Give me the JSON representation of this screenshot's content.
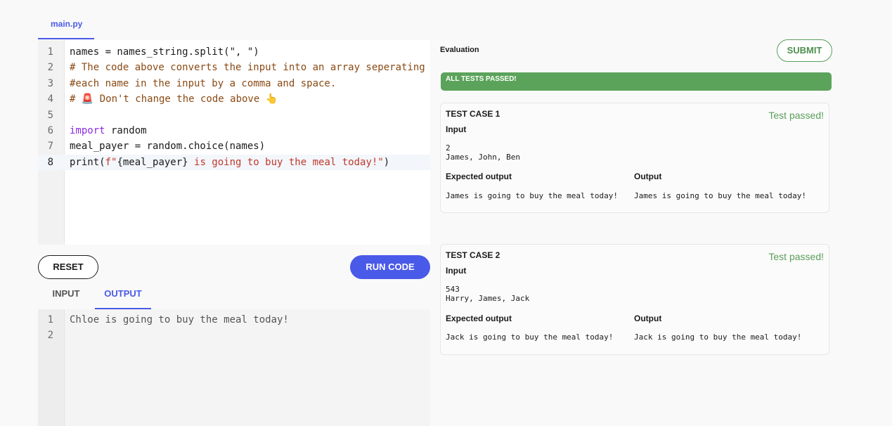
{
  "editor": {
    "file_tab": "main.py",
    "lines": [
      {
        "num": "1",
        "parts": [
          {
            "t": "names = names_string.split(\", \")",
            "c": ""
          }
        ]
      },
      {
        "num": "2",
        "parts": [
          {
            "t": "# The code above converts the input into an array seperating",
            "c": "cm"
          }
        ]
      },
      {
        "num": "3",
        "parts": [
          {
            "t": "#each name in the input by a comma and space.",
            "c": "cm"
          }
        ]
      },
      {
        "num": "4",
        "parts": [
          {
            "t": "# 🚨 Don't change the code above 👆",
            "c": "cm"
          }
        ]
      },
      {
        "num": "5",
        "parts": []
      },
      {
        "num": "6",
        "parts": [
          {
            "t": "import",
            "c": "kw"
          },
          {
            "t": " random",
            "c": ""
          }
        ]
      },
      {
        "num": "7",
        "parts": [
          {
            "t": "meal_payer = random.choice(names)",
            "c": ""
          }
        ]
      },
      {
        "num": "8",
        "parts": [
          {
            "t": "print(",
            "c": ""
          },
          {
            "t": "f\"",
            "c": "str"
          },
          {
            "t": "{meal_payer}",
            "c": ""
          },
          {
            "t": " is going to buy the meal today!\"",
            "c": "str"
          },
          {
            "t": ")",
            "c": ""
          }
        ]
      }
    ],
    "active_line": 8
  },
  "controls": {
    "reset_label": "RESET",
    "run_label": "RUN CODE",
    "input_tab": "INPUT",
    "output_tab": "OUTPUT"
  },
  "console": {
    "lines": [
      {
        "num": "1",
        "text": "Chloe is going to buy the meal today!"
      },
      {
        "num": "2",
        "text": ""
      }
    ]
  },
  "evaluation": {
    "title": "Evaluation",
    "submit_label": "SUBMIT",
    "banner": "ALL TESTS PASSED!",
    "input_label": "Input",
    "expected_label": "Expected output",
    "output_label": "Output",
    "cases": [
      {
        "title": "TEST CASE 1",
        "status": "Test passed!",
        "input": "2\nJames, John, Ben",
        "expected": "James is going to buy the meal today!",
        "output": "James is going to buy the meal today!"
      },
      {
        "title": "TEST CASE 2",
        "status": "Test passed!",
        "input": "543\nHarry, James, Jack",
        "expected": "Jack is going to buy the meal today!",
        "output": "Jack is going to buy the meal today!"
      }
    ]
  },
  "colors": {
    "accent": "#4a5ae8",
    "success": "#5ba35b"
  }
}
